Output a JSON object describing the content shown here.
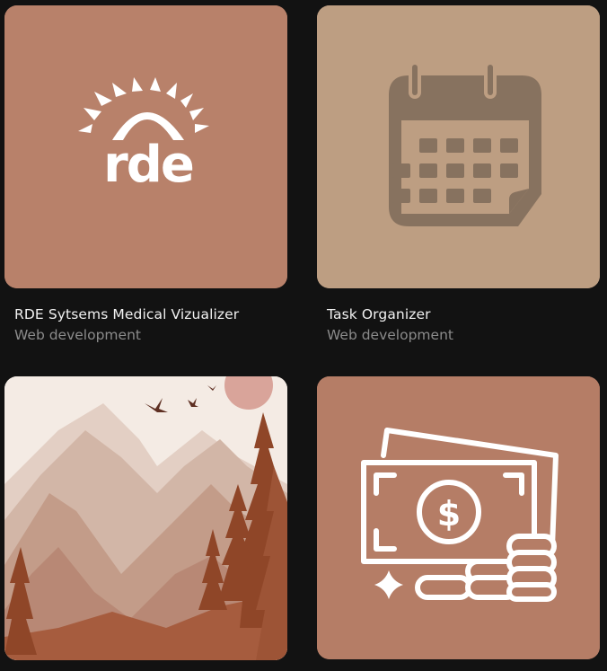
{
  "projects": [
    {
      "title": "RDE Sytsems Medical Vizualizer",
      "category": "Web development",
      "image_icon": "rde-logo",
      "bg_color": "#b8816a"
    },
    {
      "title": "Task Organizer",
      "category": "Web development",
      "image_icon": "calendar-icon",
      "bg_color": "#bd9e82"
    },
    {
      "title": "",
      "category": "",
      "image_icon": "mountain-landscape",
      "bg_color": "#f3e9e2"
    },
    {
      "title": "",
      "category": "",
      "image_icon": "money-icon",
      "bg_color": "#b57d66"
    }
  ],
  "logo_text": "rde",
  "colors": {
    "page_bg": "#121212",
    "title": "#f1f1f1",
    "subtitle": "#8b8b8b"
  }
}
